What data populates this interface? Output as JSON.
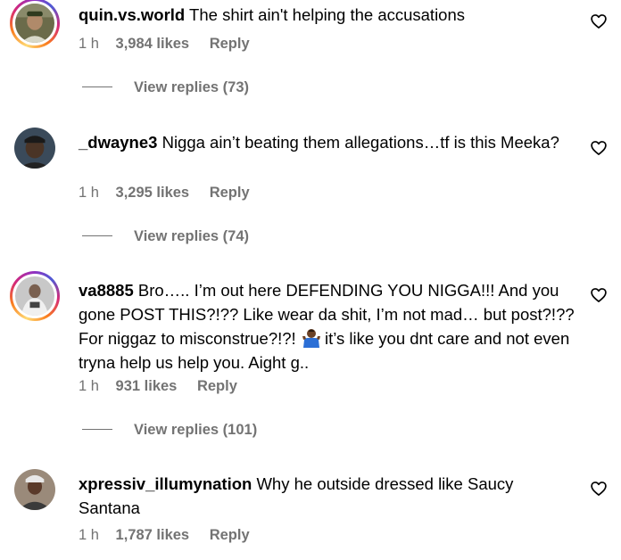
{
  "comments": [
    {
      "username": "quin.vs.world",
      "text": "The shirt ain't helping the accusations",
      "time": "1 h",
      "likes": "3,984 likes",
      "reply_label": "Reply",
      "view_replies": "View replies (73)",
      "story_ring": true
    },
    {
      "username": "_dwayne3",
      "text": "Nigga ain’t beating them allegations…tf is this Meeka?",
      "time": "1 h",
      "likes": "3,295 likes",
      "reply_label": "Reply",
      "view_replies": "View replies (74)",
      "story_ring": false
    },
    {
      "username": "va8885",
      "text_before_emoji": "Bro….. I’m out here DEFENDING YOU NIGGA!!! And you gone POST THIS?!?? Like wear da shit, I’m not mad… but post?!?? For niggaz to misconstrue?!?!",
      "emoji": "man-shrugging-emoji",
      "text_after_emoji": "it’s like you dnt care and not even tryna help us help you. Aight g..",
      "time": "1 h",
      "likes": "931 likes",
      "reply_label": "Reply",
      "view_replies": "View replies (101)",
      "story_ring": true
    },
    {
      "username": "xpressiv_illumynation",
      "text": "Why he outside dressed like Saucy Santana",
      "time": "1 h",
      "likes": "1,787 likes",
      "reply_label": "Reply",
      "story_ring": false
    }
  ],
  "icons": {
    "like": "heart-outline-icon"
  },
  "colors": {
    "secondary_text": "#737373",
    "primary_text": "#000000"
  }
}
